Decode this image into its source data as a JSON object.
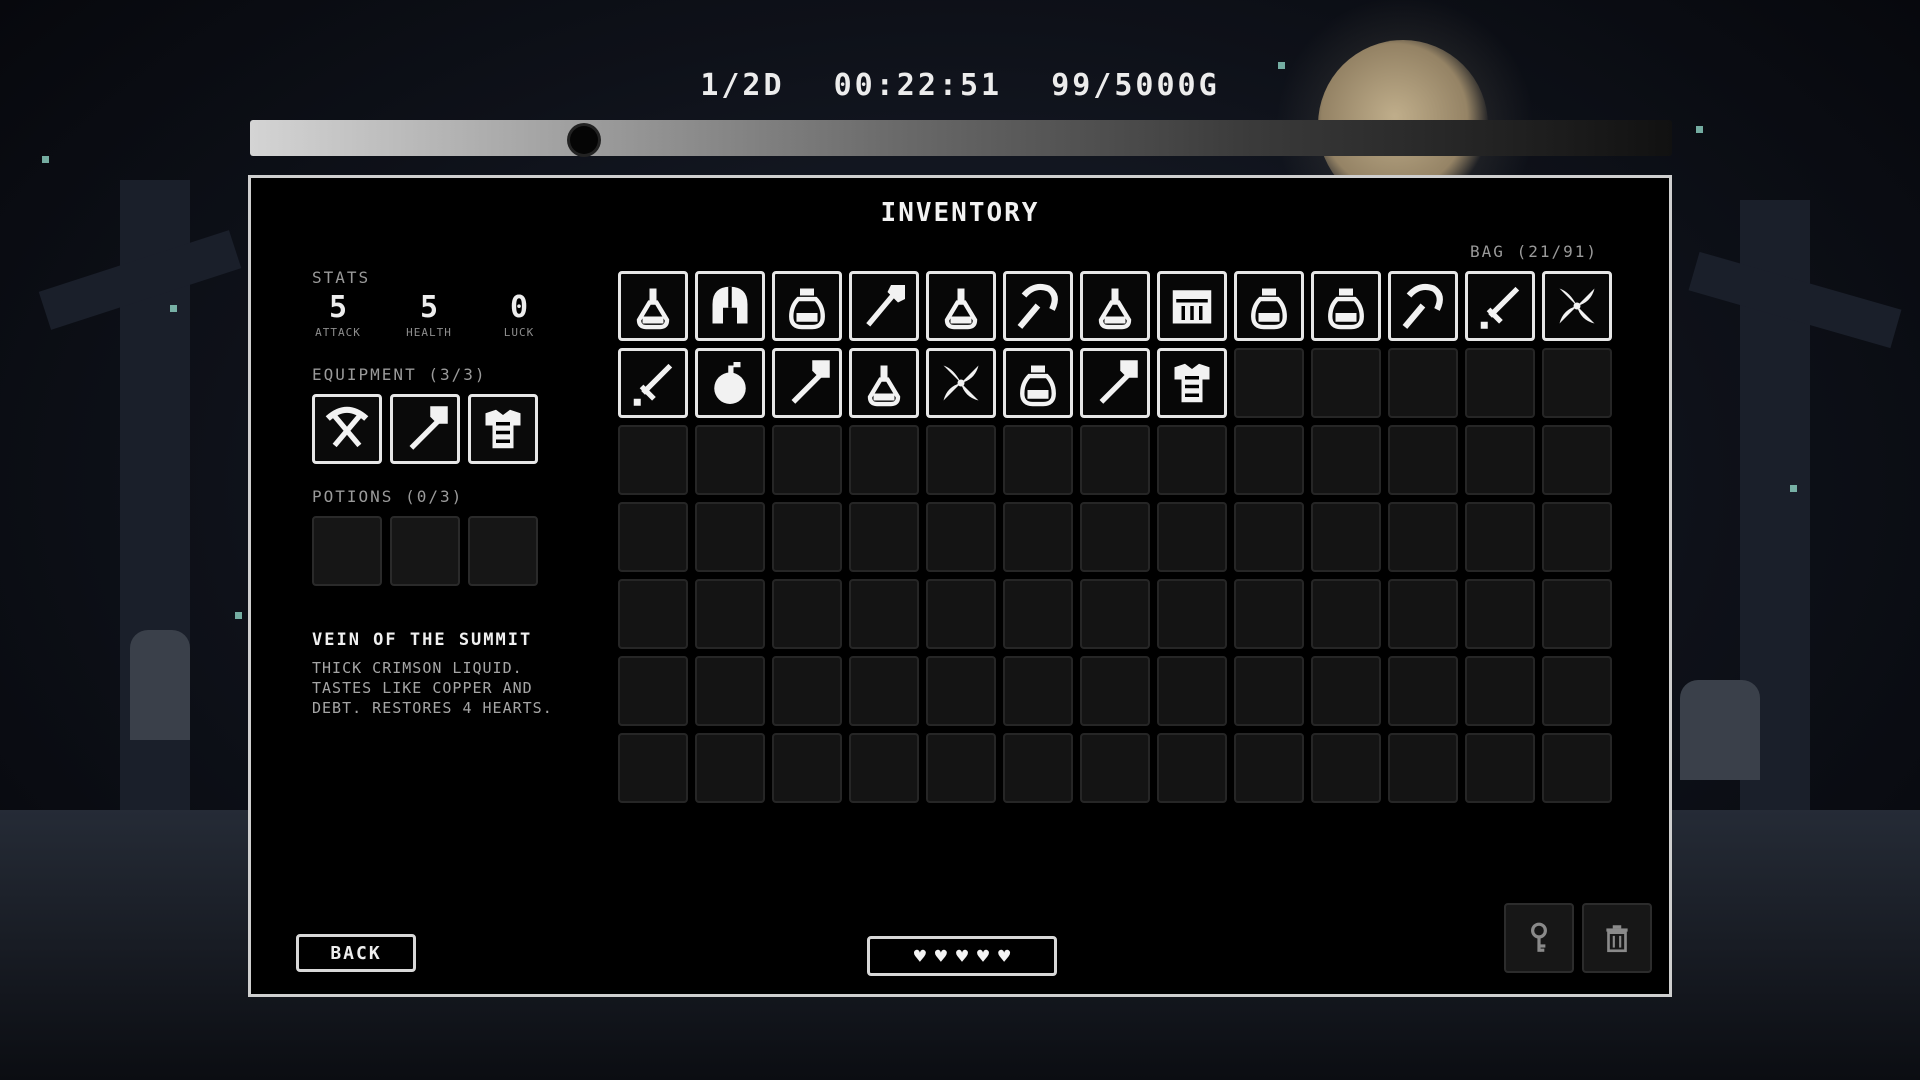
{
  "hud": {
    "day": "1/2D",
    "clock": "00:22:51",
    "gold": "99/5000G",
    "time_progress": 0.235
  },
  "panel": {
    "title": "INVENTORY"
  },
  "stats": {
    "label": "STATS",
    "items": [
      {
        "value": "5",
        "label": "ATTACK"
      },
      {
        "value": "5",
        "label": "HEALTH"
      },
      {
        "value": "0",
        "label": "LUCK"
      }
    ]
  },
  "equipment": {
    "label": "EQUIPMENT (3/3)",
    "slots": [
      "pickaxe-icon",
      "shovel-icon",
      "armor-icon"
    ]
  },
  "potions": {
    "label": "POTIONS (0/3)",
    "slots": [
      "",
      "",
      ""
    ]
  },
  "selected_item": {
    "name": "VEIN OF THE SUMMIT",
    "description": "THICK CRIMSON LIQUID. TASTES LIKE COPPER AND DEBT. RESTORES 4 HEARTS."
  },
  "bag": {
    "label": "BAG (21/91)",
    "items": [
      "flask-icon",
      "helmet-icon",
      "jar-icon",
      "wand-icon",
      "flask-icon",
      "sickle-icon",
      "flask-icon",
      "chest-icon",
      "jar-icon",
      "jar-icon",
      "sickle-icon",
      "sword-icon",
      "herb-icon",
      "sword-icon",
      "bomb-icon",
      "shovel-icon",
      "flask-icon",
      "herb-icon",
      "jar-icon",
      "shovel-icon",
      "armor-icon"
    ]
  },
  "footer": {
    "back_label": "BACK",
    "hearts": [
      "♥",
      "♥",
      "♥",
      "♥",
      "♥"
    ],
    "hearts_filled": 5
  },
  "tools": {
    "key_icon": "key-icon",
    "trash_icon": "trash-icon"
  }
}
